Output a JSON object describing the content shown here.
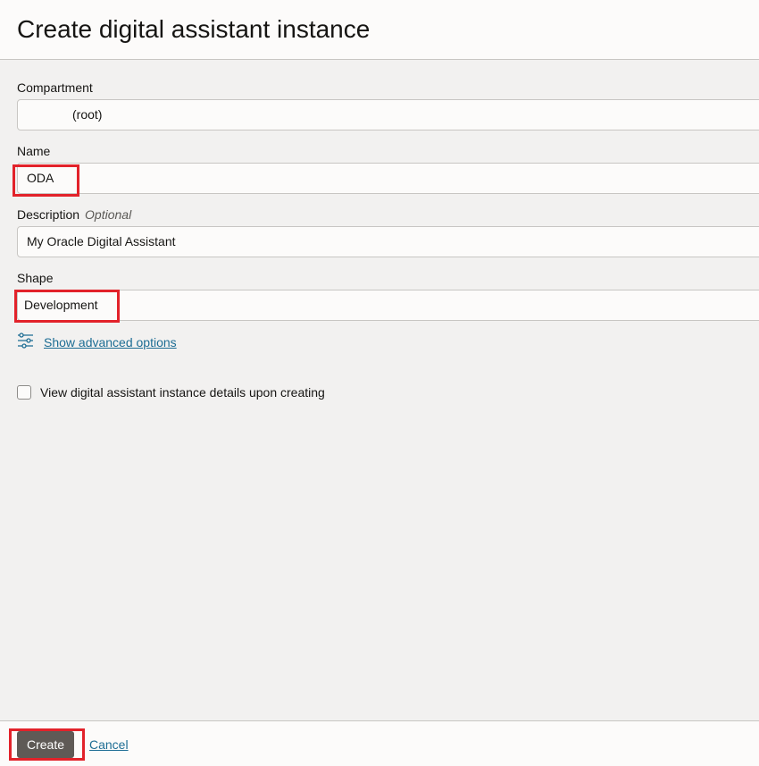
{
  "header": {
    "title": "Create digital assistant instance"
  },
  "form": {
    "compartment": {
      "label": "Compartment",
      "value": "(root)"
    },
    "name": {
      "label": "Name",
      "value": "ODA"
    },
    "description": {
      "label": "Description",
      "optional": "Optional",
      "value": "My Oracle Digital Assistant"
    },
    "shape": {
      "label": "Shape",
      "value": "Development"
    },
    "advanced": {
      "link_text": "Show advanced options",
      "icon": "sliders-icon"
    },
    "view_details": {
      "label": "View digital assistant instance details upon creating",
      "checked": false
    }
  },
  "footer": {
    "create_label": "Create",
    "cancel_label": "Cancel"
  },
  "colors": {
    "highlight": "#e2222a",
    "link": "#1d6d94",
    "primary_button": "#5f5a56"
  }
}
